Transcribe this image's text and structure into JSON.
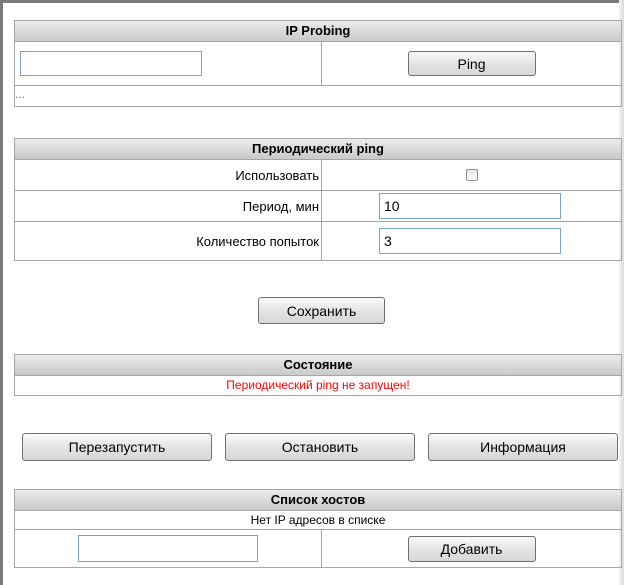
{
  "ip_probing": {
    "title": "IP Probing",
    "address_value": "",
    "ping_label": "Ping",
    "result_text": "..."
  },
  "periodic_ping": {
    "title": "Периодический ping",
    "use_label": "Использовать",
    "use_checked": false,
    "period_label": "Период, мин",
    "period_value": "10",
    "attempts_label": "Количество попыток",
    "attempts_value": "3"
  },
  "save_label": "Сохранить",
  "status": {
    "title": "Состояние",
    "message": "Периодический ping не запущен!",
    "message_color": "#ff0000"
  },
  "actions": {
    "restart_label": "Перезапустить",
    "stop_label": "Остановить",
    "info_label": "Информация"
  },
  "hosts": {
    "title": "Список хостов",
    "empty_text": "Нет IP адресов в списке",
    "new_host_value": "",
    "add_label": "Добавить"
  }
}
